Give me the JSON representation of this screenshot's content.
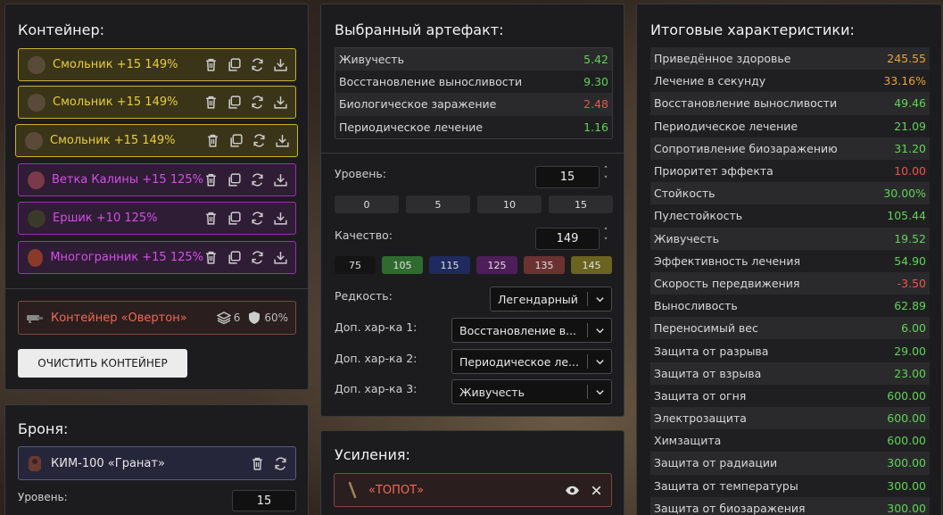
{
  "container": {
    "title": "Контейнер:",
    "items": [
      {
        "label": "Смольник +15 149%",
        "color": "gold"
      },
      {
        "label": "Смольник +15 149%",
        "color": "gold"
      },
      {
        "label": "Смольник +15 149%",
        "color": "gold"
      },
      {
        "label": "Ветка Калины +15 125%",
        "color": "purple"
      },
      {
        "label": "Ершик +10 125%",
        "color": "purple"
      },
      {
        "label": "Многогранник +15 125%",
        "color": "purple"
      }
    ],
    "overton": {
      "label": "Контейнер «Овертон»",
      "slots": "6",
      "protection": "60%"
    },
    "clear_label": "ОЧИСТИТЬ КОНТЕЙНЕР"
  },
  "armor": {
    "title": "Броня:",
    "item_label": "КИМ-100 «Гранат»",
    "level_label": "Уровень:",
    "level_value": "15"
  },
  "artifact": {
    "title": "Выбранный артефакт:",
    "stats": [
      {
        "name": "Живучесть",
        "value": "5.42",
        "tone": "green"
      },
      {
        "name": "Восстановление выносливости",
        "value": "9.30",
        "tone": "green"
      },
      {
        "name": "Биологическое заражение",
        "value": "2.48",
        "tone": "red"
      },
      {
        "name": "Периодическое лечение",
        "value": "1.16",
        "tone": "green"
      }
    ],
    "level_label": "Уровень:",
    "level_value": "15",
    "level_presets": [
      "0",
      "5",
      "10",
      "15"
    ],
    "quality_label": "Качество:",
    "quality_value": "149",
    "quality_presets": [
      {
        "label": "75",
        "color": "#141414"
      },
      {
        "label": "105",
        "color": "#2f6b2f"
      },
      {
        "label": "115",
        "color": "#1f2a5e"
      },
      {
        "label": "125",
        "color": "#4e1e5a"
      },
      {
        "label": "135",
        "color": "#6b3232"
      },
      {
        "label": "145",
        "color": "#6b6320"
      }
    ],
    "rarity_label": "Редкость:",
    "rarity_value": "Легендарный",
    "extra1_label": "Доп. хар-ка 1:",
    "extra1_value": "Восстановление в...",
    "extra2_label": "Доп. хар-ка 2:",
    "extra2_value": "Периодическое ле...",
    "extra3_label": "Доп. хар-ка 3:",
    "extra3_value": "Живучесть"
  },
  "boosts": {
    "title": "Усиления:",
    "item_label": "«ТОПОТ»"
  },
  "summary": {
    "title": "Итоговые характеристики:",
    "stats": [
      {
        "name": "Приведённое здоровье",
        "value": "245.55",
        "tone": "orange"
      },
      {
        "name": "Лечение в секунду",
        "value": "33.16%",
        "tone": "orange"
      },
      {
        "name": "Восстановление выносливости",
        "value": "49.46",
        "tone": "green"
      },
      {
        "name": "Периодическое лечение",
        "value": "21.09",
        "tone": "green"
      },
      {
        "name": "Сопротивление биозаражению",
        "value": "31.20",
        "tone": "green"
      },
      {
        "name": "Приоритет эффекта",
        "value": "10.00",
        "tone": "red"
      },
      {
        "name": "Стойкость",
        "value": "30.00%",
        "tone": "green"
      },
      {
        "name": "Пулестойкость",
        "value": "105.44",
        "tone": "green"
      },
      {
        "name": "Живучесть",
        "value": "19.52",
        "tone": "green"
      },
      {
        "name": "Эффективность лечения",
        "value": "54.90",
        "tone": "green"
      },
      {
        "name": "Скорость передвижения",
        "value": "-3.50",
        "tone": "red"
      },
      {
        "name": "Выносливость",
        "value": "62.89",
        "tone": "green"
      },
      {
        "name": "Переносимый вес",
        "value": "6.00",
        "tone": "green"
      },
      {
        "name": "Защита от разрыва",
        "value": "29.00",
        "tone": "green"
      },
      {
        "name": "Защита от взрыва",
        "value": "23.00",
        "tone": "green"
      },
      {
        "name": "Защита от огня",
        "value": "600.00",
        "tone": "green"
      },
      {
        "name": "Электрозащита",
        "value": "600.00",
        "tone": "green"
      },
      {
        "name": "Химзащита",
        "value": "600.00",
        "tone": "green"
      },
      {
        "name": "Защита от радиации",
        "value": "300.00",
        "tone": "green"
      },
      {
        "name": "Защита от температуры",
        "value": "300.00",
        "tone": "green"
      },
      {
        "name": "Защита от биозаражения",
        "value": "300.00",
        "tone": "green"
      }
    ]
  }
}
